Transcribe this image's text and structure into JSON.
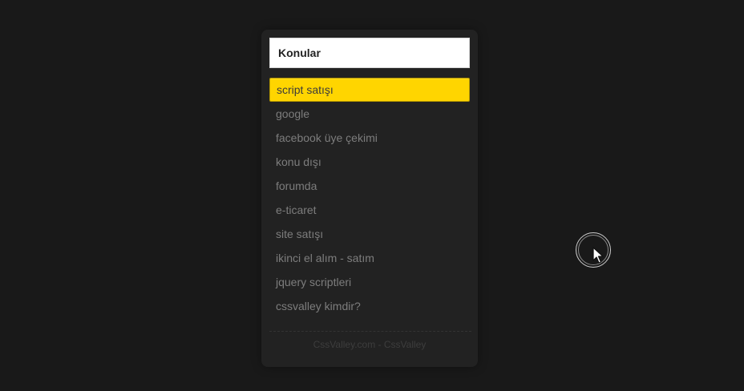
{
  "panel": {
    "header_title": "Konular",
    "items": [
      {
        "label": "script satışı",
        "active": true
      },
      {
        "label": "google",
        "active": false
      },
      {
        "label": "facebook üye çekimi",
        "active": false
      },
      {
        "label": "konu dışı",
        "active": false
      },
      {
        "label": "forumda",
        "active": false
      },
      {
        "label": "e-ticaret",
        "active": false
      },
      {
        "label": "site satışı",
        "active": false
      },
      {
        "label": "ikinci el alım - satım",
        "active": false
      },
      {
        "label": "jquery scriptleri",
        "active": false
      },
      {
        "label": "cssvalley kimdir?",
        "active": false
      }
    ],
    "footer_text": "CssValley.com - CssValley"
  },
  "colors": {
    "background": "#191919",
    "panel": "#222222",
    "accent": "#ffd500",
    "item_text": "#7d7d7d"
  },
  "icons": {
    "cursor": "mouse-pointer-icon"
  }
}
